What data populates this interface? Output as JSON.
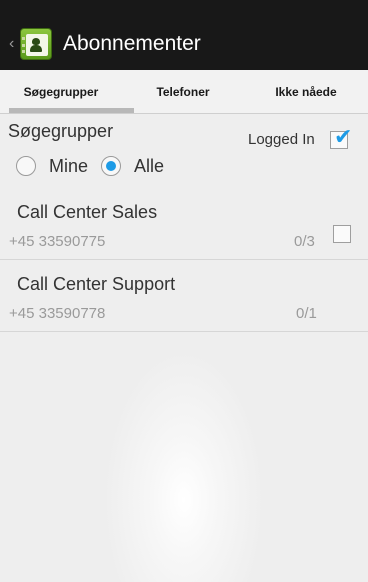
{
  "app": {
    "title": "Abonnementer"
  },
  "tabs": [
    {
      "label": "Søgegrupper",
      "selected": true
    },
    {
      "label": "Telefoner",
      "selected": false
    },
    {
      "label": "Ikke nåede",
      "selected": false
    }
  ],
  "section": {
    "title": "Søgegrupper",
    "logged_in_label": "Logged In",
    "logged_in_checked": true
  },
  "filter": {
    "options": [
      {
        "label": "Mine",
        "selected": false
      },
      {
        "label": "Alle",
        "selected": true
      }
    ]
  },
  "groups": [
    {
      "name": "Call Center Sales",
      "phone": "+45 33590775",
      "count": "0/3",
      "checked": false
    },
    {
      "name": "Call Center Support",
      "phone": "+45 33590778",
      "count": "0/1"
    }
  ],
  "colors": {
    "accent": "#1e9be6",
    "action_bar": "#181818",
    "tab_indicator": "#b8b8b8"
  }
}
